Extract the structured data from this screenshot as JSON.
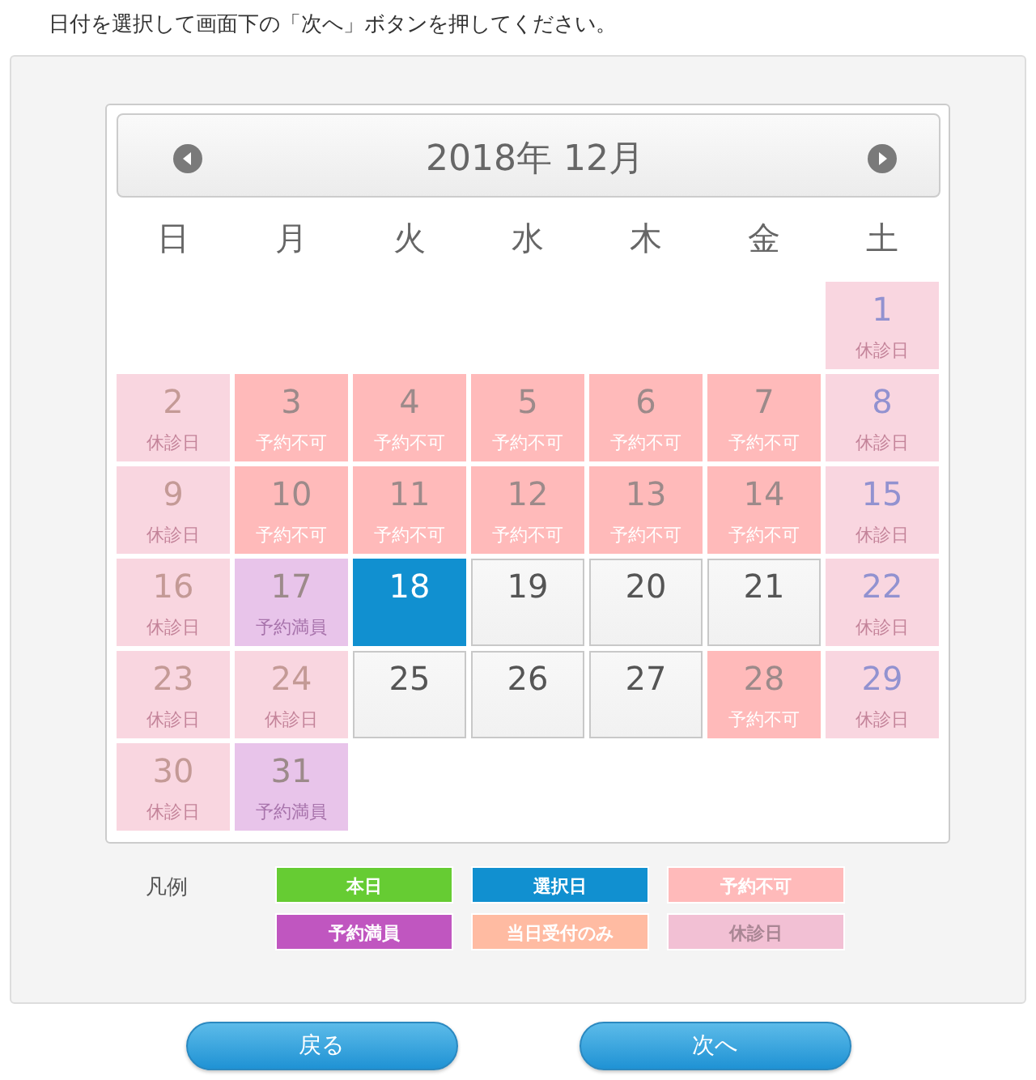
{
  "instruction": "日付を選択して画面下の「次へ」ボタンを押してください。",
  "calendar": {
    "title": "2018年 12月",
    "weekdays": [
      "日",
      "月",
      "火",
      "水",
      "木",
      "金",
      "土"
    ],
    "weeks": [
      [
        {
          "day": "1",
          "kind": "holiday",
          "label": "休診日",
          "selected": false
        }
      ],
      [
        {
          "day": "2",
          "kind": "holiday",
          "label": "休診日",
          "selected": false
        },
        {
          "day": "3",
          "kind": "unavailable",
          "label": "予約不可",
          "selected": false
        },
        {
          "day": "4",
          "kind": "unavailable",
          "label": "予約不可",
          "selected": false
        },
        {
          "day": "5",
          "kind": "unavailable",
          "label": "予約不可",
          "selected": false
        },
        {
          "day": "6",
          "kind": "unavailable",
          "label": "予約不可",
          "selected": false
        },
        {
          "day": "7",
          "kind": "unavailable",
          "label": "予約不可",
          "selected": false
        },
        {
          "day": "8",
          "kind": "holiday",
          "label": "休診日",
          "selected": false
        }
      ],
      [
        {
          "day": "9",
          "kind": "holiday",
          "label": "休診日",
          "selected": false
        },
        {
          "day": "10",
          "kind": "unavailable",
          "label": "予約不可",
          "selected": false
        },
        {
          "day": "11",
          "kind": "unavailable",
          "label": "予約不可",
          "selected": false
        },
        {
          "day": "12",
          "kind": "unavailable",
          "label": "予約不可",
          "selected": false
        },
        {
          "day": "13",
          "kind": "unavailable",
          "label": "予約不可",
          "selected": false
        },
        {
          "day": "14",
          "kind": "unavailable",
          "label": "予約不可",
          "selected": false
        },
        {
          "day": "15",
          "kind": "holiday",
          "label": "休診日",
          "selected": false
        }
      ],
      [
        {
          "day": "16",
          "kind": "holiday",
          "label": "休診日",
          "selected": false
        },
        {
          "day": "17",
          "kind": "full",
          "label": "予約満員",
          "selected": false
        },
        {
          "day": "18",
          "kind": "open",
          "selected": true
        },
        {
          "day": "19",
          "kind": "open",
          "selected": false
        },
        {
          "day": "20",
          "kind": "open",
          "selected": false
        },
        {
          "day": "21",
          "kind": "open",
          "selected": false
        },
        {
          "day": "22",
          "kind": "holiday",
          "label": "休診日",
          "selected": false
        }
      ],
      [
        {
          "day": "23",
          "kind": "holiday",
          "label": "休診日",
          "selected": false
        },
        {
          "day": "24",
          "kind": "holiday",
          "label": "休診日",
          "selected": false
        },
        {
          "day": "25",
          "kind": "open",
          "selected": false
        },
        {
          "day": "26",
          "kind": "open",
          "selected": false
        },
        {
          "day": "27",
          "kind": "open",
          "selected": false
        },
        {
          "day": "28",
          "kind": "unavailable",
          "label": "予約不可",
          "selected": false
        },
        {
          "day": "29",
          "kind": "holiday",
          "label": "休診日",
          "selected": false
        }
      ],
      [
        {
          "day": "30",
          "kind": "holiday",
          "label": "休診日",
          "selected": false
        },
        {
          "day": "31",
          "kind": "full",
          "label": "予約満員",
          "selected": false
        }
      ]
    ]
  },
  "legend": {
    "title": "凡例",
    "items": [
      {
        "label": "本日",
        "color": "#66cc33"
      },
      {
        "label": "選択日",
        "color": "#1190d0"
      },
      {
        "label": "予約不可",
        "color": "#ffbaba"
      },
      {
        "label": "予約満員",
        "color": "#c056c0"
      },
      {
        "label": "当日受付のみ",
        "color": "#ffbba2"
      },
      {
        "label": "休診日",
        "color": "#f2c0d4"
      }
    ]
  },
  "buttons": [
    {
      "label": "戻る"
    },
    {
      "label": "次へ"
    }
  ]
}
